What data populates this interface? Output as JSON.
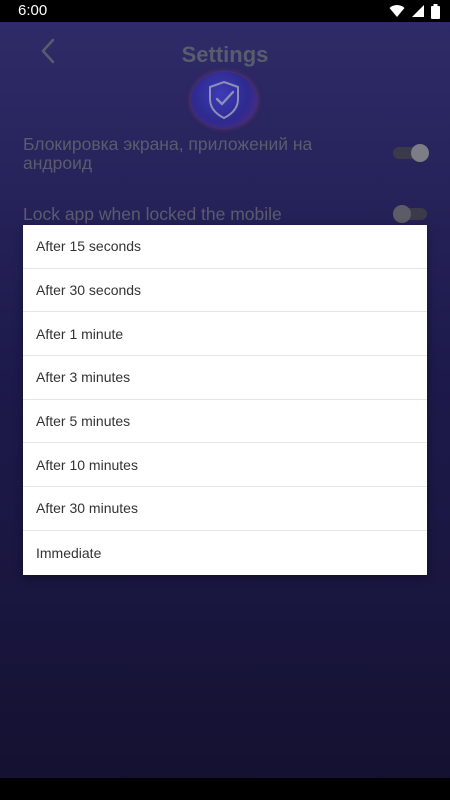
{
  "status_bar": {
    "time": "6:00"
  },
  "header": {
    "title": "Settings"
  },
  "settings": {
    "lock_screen_label": "Блокировка экрана, приложений на андроид",
    "lock_app_label": "Lock app when locked the mobile"
  },
  "dialog": {
    "options": [
      {
        "label": "After 15 seconds"
      },
      {
        "label": "After 30 seconds"
      },
      {
        "label": "After 1 minute"
      },
      {
        "label": "After 3 minutes"
      },
      {
        "label": "After 5 minutes"
      },
      {
        "label": "After 10 minutes"
      },
      {
        "label": "After 30 minutes"
      },
      {
        "label": "Immediate"
      }
    ]
  }
}
